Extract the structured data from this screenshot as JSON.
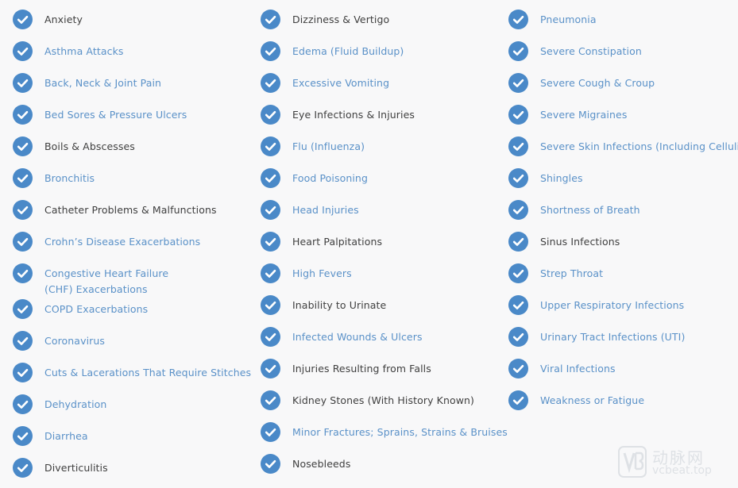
{
  "columns": [
    [
      {
        "label": "Anxiety",
        "link": false
      },
      {
        "label": "Asthma Attacks",
        "link": true
      },
      {
        "label": "Back, Neck & Joint Pain",
        "link": true
      },
      {
        "label": "Bed Sores & Pressure Ulcers",
        "link": true
      },
      {
        "label": "Boils & Abscesses",
        "link": false
      },
      {
        "label": "Bronchitis",
        "link": true
      },
      {
        "label": "Catheter Problems & Malfunctions",
        "link": false
      },
      {
        "label": "Crohn’s Disease Exacerbations",
        "link": true
      },
      {
        "label": "Congestive Heart Failure (CHF) Exacerbations",
        "link": true
      },
      {
        "label": "COPD Exacerbations",
        "link": true
      },
      {
        "label": "Coronavirus",
        "link": true
      },
      {
        "label": "Cuts & Lacerations That Require Stitches",
        "link": true
      },
      {
        "label": "Dehydration",
        "link": true
      },
      {
        "label": "Diarrhea",
        "link": true
      },
      {
        "label": "Diverticulitis",
        "link": false
      }
    ],
    [
      {
        "label": "Dizziness & Vertigo",
        "link": false
      },
      {
        "label": "Edema (Fluid Buildup)",
        "link": true
      },
      {
        "label": "Excessive Vomiting",
        "link": true
      },
      {
        "label": "Eye Infections & Injuries",
        "link": false
      },
      {
        "label": "Flu (Influenza)",
        "link": true
      },
      {
        "label": "Food Poisoning",
        "link": true
      },
      {
        "label": "Head Injuries",
        "link": true
      },
      {
        "label": "Heart Palpitations",
        "link": false
      },
      {
        "label": "High Fevers",
        "link": true
      },
      {
        "label": "Inability to Urinate",
        "link": false
      },
      {
        "label": "Infected Wounds & Ulcers",
        "link": true
      },
      {
        "label": "Injuries Resulting from Falls",
        "link": false
      },
      {
        "label": "Kidney Stones (With History Known)",
        "link": false
      },
      {
        "label": "Minor Fractures; Sprains, Strains & Bruises",
        "link": true
      },
      {
        "label": "Nosebleeds",
        "link": false
      }
    ],
    [
      {
        "label": "Pneumonia",
        "link": true
      },
      {
        "label": "Severe Constipation",
        "link": true
      },
      {
        "label": "Severe Cough & Croup",
        "link": true
      },
      {
        "label": "Severe Migraines",
        "link": true
      },
      {
        "label": "Severe Skin Infections (Including Cellulitis)",
        "link": true
      },
      {
        "label": "Shingles",
        "link": true
      },
      {
        "label": "Shortness of Breath",
        "link": true
      },
      {
        "label": "Sinus Infections",
        "link": false
      },
      {
        "label": "Strep Throat",
        "link": true
      },
      {
        "label": "Upper Respiratory Infections",
        "link": true
      },
      {
        "label": "Urinary Tract Infections (UTI)",
        "link": true
      },
      {
        "label": "Viral Infections",
        "link": true
      },
      {
        "label": "Weakness or Fatigue",
        "link": true
      }
    ]
  ],
  "colors": {
    "check_bg": "#4a89c8",
    "link_text": "#5a91c8",
    "plain_text": "#3f3f3f"
  },
  "watermark": {
    "cn": "动脉网",
    "en": "vcbeat.top",
    "mark_icon": "vb-logo-icon"
  }
}
